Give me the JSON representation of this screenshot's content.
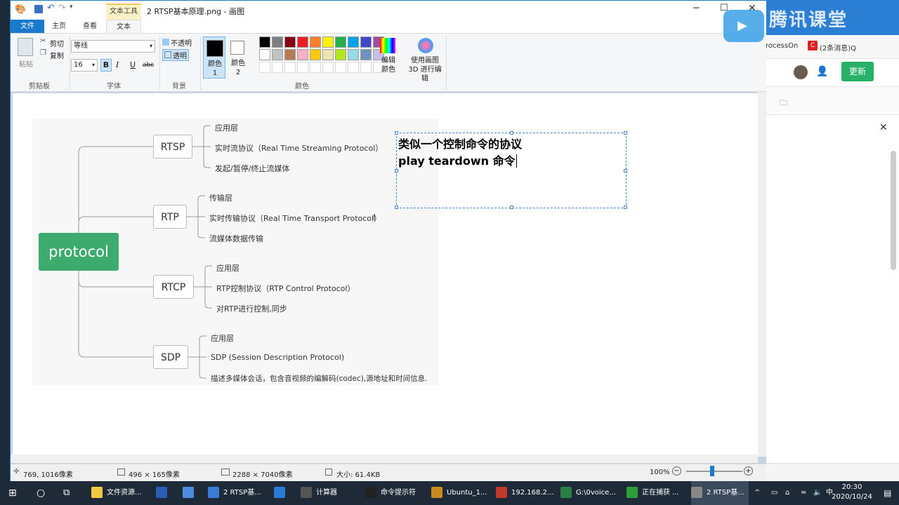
{
  "window": {
    "title": "2 RTSP基本原理.png - 画图",
    "tool_context": "文本工具"
  },
  "ribbon_tabs": [
    "文件",
    "主页",
    "查看",
    "文本"
  ],
  "clipboard": {
    "paste": "粘贴",
    "cut": "剪切",
    "copy": "复制",
    "group": "剪贴板"
  },
  "font": {
    "family": "等线",
    "size": "16",
    "bold": "B",
    "italic": "I",
    "underline": "U",
    "strike": "abc",
    "group": "字体"
  },
  "background": {
    "opaque": "不透明",
    "transparent": "透明",
    "group": "背景"
  },
  "colors": {
    "color1": "颜色 1",
    "color2": "颜色 2",
    "edit": "编辑颜色",
    "paint3d": "使用画图 3D 进行编辑",
    "group": "颜色",
    "palette": [
      "#000000",
      "#7f7f7f",
      "#880015",
      "#ed1c24",
      "#ff7f27",
      "#fff200",
      "#22b14c",
      "#00a2e8",
      "#3f48cc",
      "#a349a4",
      "#ffffff",
      "#c3c3c3",
      "#b97a57",
      "#ffaec9",
      "#ffc90e",
      "#efe4b0",
      "#b5e61d",
      "#99d9ea",
      "#7092be",
      "#c8bfe7"
    ]
  },
  "mindmap": {
    "root": "protocol",
    "branches": [
      {
        "name": "RTSP",
        "items": [
          "应用层",
          "实时流协议（Real Time Streaming Protocol）",
          "发起/暂停/终止流媒体"
        ]
      },
      {
        "name": "RTP",
        "items": [
          "传输层",
          "实时传输协议（Real Time Transport Protocol）",
          "流媒体数据传输"
        ]
      },
      {
        "name": "RTCP",
        "items": [
          "应用层",
          "RTP控制协议（RTP Control Protocol）",
          "对RTP进行控制,同步"
        ]
      },
      {
        "name": "SDP",
        "items": [
          "应用层",
          "SDP (Session Description Protocol)",
          "描述多媒体会话，包含音视频的编解码(codec),源地址和时间信息."
        ]
      }
    ]
  },
  "textbox": {
    "line1": "类似一个控制命令的协议",
    "line2": "play teardown 命令"
  },
  "status": {
    "cursor": "769, 1016像素",
    "selection": "496 × 165像素",
    "image": "2288 × 7040像素",
    "size": "大小: 61.4KB",
    "zoom": "100%"
  },
  "bg_app": {
    "tab1": "rocessOn",
    "tab2": "(2条消息)Q",
    "update": "更新",
    "brand": "腾讯课堂"
  },
  "taskbar": {
    "items": [
      "文件资源...",
      "",
      "",
      "2 RTSP基...",
      "",
      "计算器",
      "命令提示符",
      "Ubuntu_1...",
      "192.168.2...",
      "G:\\0voice...",
      "正在捕获 ...",
      "2 RTSP基..."
    ],
    "time": "20:30",
    "date": "2020/10/24"
  }
}
